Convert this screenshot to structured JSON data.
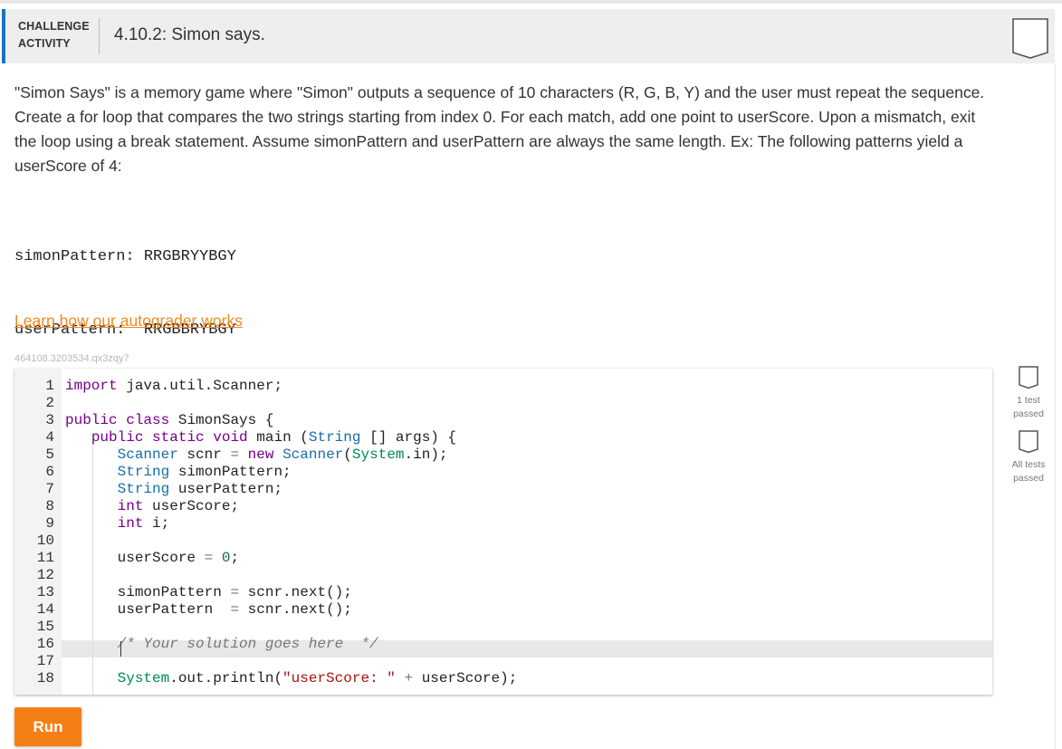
{
  "header": {
    "category_line1": "CHALLENGE",
    "category_line2": "ACTIVITY",
    "title": "4.10.2: Simon says."
  },
  "prompt": {
    "text": "\"Simon Says\" is a memory game where \"Simon\" outputs a sequence of 10 characters (R, G, B, Y) and the user must repeat the sequence. Create a for loop that compares the two strings starting from index 0. For each match, add one point to userScore. Upon a mismatch, exit the loop using a break statement. Assume simonPattern and userPattern are always the same length. Ex: The following patterns yield a userScore of 4:",
    "example_line1": "simonPattern: RRGBRYYBGY",
    "example_line2": "userPattern:  RRGBBRYBGY"
  },
  "links": {
    "learn": "Learn how our autograder works"
  },
  "activity_id": "464108.3203534.qx3zqy7",
  "editor": {
    "line_numbers": [
      "1",
      "2",
      "3",
      "4",
      "5",
      "6",
      "7",
      "8",
      "9",
      "10",
      "11",
      "12",
      "13",
      "14",
      "15",
      "16",
      "17",
      "18"
    ],
    "lines": [
      "import java.util.Scanner;",
      "",
      "public class SimonSays {",
      "   public static void main (String [] args) {",
      "      Scanner scnr = new Scanner(System.in);",
      "      String simonPattern;",
      "      String userPattern;",
      "      int userScore;",
      "      int i;",
      "",
      "      userScore = 0;",
      "",
      "      simonPattern = scnr.next();",
      "      userPattern  = scnr.next();",
      "",
      "      /* Your solution goes here  */",
      "",
      "      System.out.println(\"userScore: \" + userScore);"
    ],
    "active_line": 16
  },
  "tests": {
    "test1_line1": "1 test",
    "test1_line2": "passed",
    "test2_line1": "All tests",
    "test2_line2": "passed"
  },
  "buttons": {
    "run": "Run"
  },
  "colors": {
    "accent": "#1b75bb",
    "run_button": "#f57f17",
    "link": "#f08a1f"
  },
  "icons": {
    "completion": "shield-outline-icon",
    "test_status": "shield-outline-icon"
  }
}
